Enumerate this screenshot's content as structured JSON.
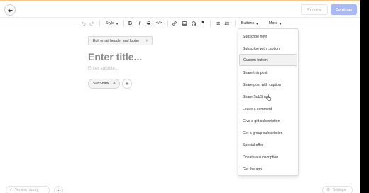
{
  "header": {
    "back_icon": "arrow-left-icon",
    "preview_label": "Preview",
    "continue_label": "Continue",
    "continue_color": "#a9b9f5"
  },
  "toolbar": {
    "undo_icon": "undo-icon",
    "redo_icon": "redo-icon",
    "style_label": "Style",
    "bold_label": "B",
    "italic_label": "I",
    "strikethrough_label": "S",
    "code_label": "</>",
    "buttons_label": "Buttons",
    "more_label": "More"
  },
  "editor": {
    "edit_header_label": "Edit email header and footer",
    "title_placeholder": "Enter title...",
    "subtitle_placeholder": "Enter subtitle...",
    "tag_label": "SubShark",
    "add_tag_label": "+"
  },
  "buttons_menu": {
    "items": [
      {
        "label": "Subscribe now"
      },
      {
        "label": "Subscribe with caption"
      },
      {
        "label": "Custom button"
      },
      {
        "label": "Share this post"
      },
      {
        "label": "Share post with caption"
      },
      {
        "label": "Share SubShark"
      },
      {
        "label": "Leave a comment"
      },
      {
        "label": "Give a gift subscription"
      },
      {
        "label": "Get a group subscription"
      },
      {
        "label": "Special offer"
      },
      {
        "label": "Donate a subscription"
      },
      {
        "label": "Get the app"
      }
    ],
    "highlighted": "Custom button"
  },
  "footer": {
    "version_history_label": "Version history",
    "help_icon": "help-circle-icon",
    "settings_label": "Settings"
  }
}
